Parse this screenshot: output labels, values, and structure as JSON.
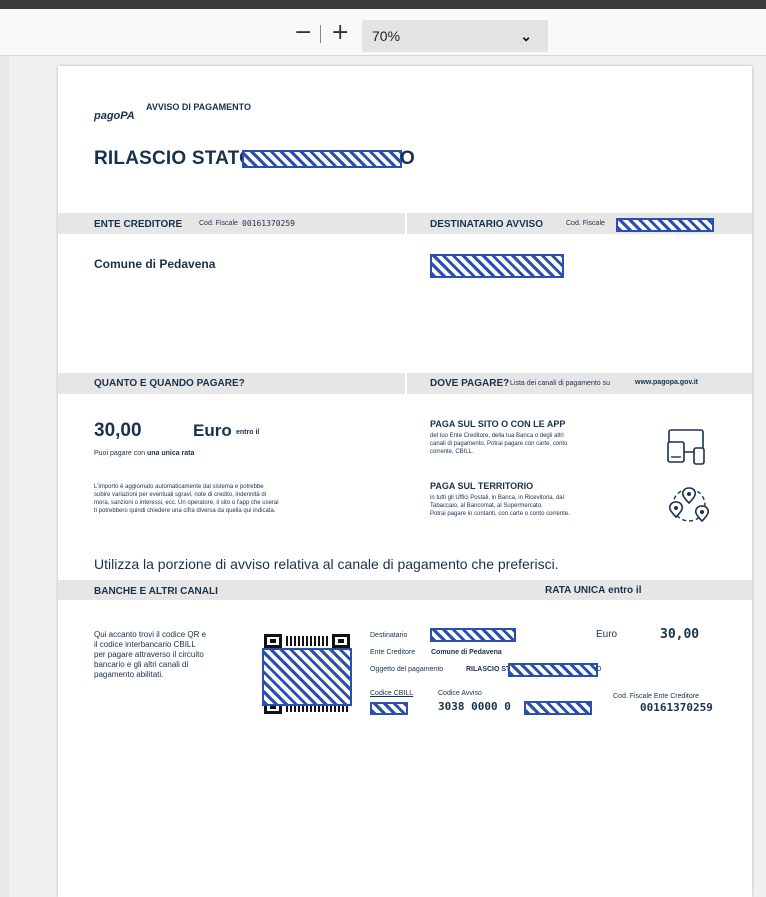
{
  "toolbar": {
    "zoom_out": "−",
    "zoom_in": "+",
    "zoom_value": "70%",
    "dropdown_chevron": "⌄"
  },
  "notice": {
    "logo": "pagoPA",
    "header": "AVVISO DI PAGAMENTO",
    "title_prefix": "RILASCIO STATO F",
    "title_suffix": "O",
    "creditor_band": "ENTE CREDITORE",
    "creditor_cf_label": "Cod. Fiscale",
    "creditor_cf": "00161370259",
    "recipient_band": "DESTINATARIO AVVISO",
    "recipient_cf_label": "Cod. Fiscale",
    "creditor_name": "Comune di Pedavena",
    "how_band": "QUANTO E QUANDO PAGARE?",
    "where_band": "DOVE PAGARE?",
    "where_note": "Lista dei canali di pagamento su",
    "where_site": "www.pagopa.gov.it",
    "amount": "30,00",
    "currency": "Euro",
    "due_label": "entro il",
    "single_prefix": "Puoi pagare con",
    "single_bold": "una unica rata",
    "update_text": [
      "L'importo è aggiornato automaticamente dal sistema e potrebbe",
      "subire variazioni per eventuali sgravi, note di credito, indennità di",
      "mora, sanzioni o interessi, ecc. Un operatore, il sito o l'app che userai",
      "ti potrebbero quindi chiedere una cifra diversa da quella qui indicata."
    ],
    "online_title": "PAGA SUL SITO O CON LE APP",
    "online_text": [
      "del tuo Ente Creditore, della tua Banca o degli altri",
      "canali di pagamento. Potrai pagare con carte, conto",
      "corrente, CBILL."
    ],
    "territory_title": "PAGA SUL TERRITORIO",
    "territory_text": [
      "in tutti gli Uffici Postali, in Banca, in Ricevitoria, dal",
      "Tabaccaio, al Bancomat, al Supermercato.",
      "Potrai pagare in contanti, con carte o conto corrente."
    ],
    "portion_text": "Utilizza la porzione di avviso relativa al canale di pagamento che preferisci.",
    "banks_band": "BANCHE E ALTRI CANALI",
    "rata_bold": "RATA UNICA",
    "rata_rest": "entro il",
    "qr_text": [
      "Qui accanto trovi il codice QR e",
      "il codice interbancario CBILL",
      "per pagare attraverso il circuito",
      "bancario e gli altri canali di",
      "pagamento abilitati."
    ],
    "dest_label": "Destinatario",
    "dest_tail": "I",
    "euro_label": "Euro",
    "euro_amount": "30,00",
    "ente_label": "Ente Creditore",
    "ente_value": "Comune di Pedavena",
    "oggetto_label": "Oggetto del pagamento",
    "oggetto_value": "RILASCIO ST",
    "oggetto_tail": "O",
    "cbill_label": "Codice CBILL",
    "avviso_label": "Codice Avviso",
    "avviso_value": "3038 0000 0",
    "cf_ente_label": "Cod. Fiscale Ente Creditore",
    "cf_ente_value": "00161370259"
  }
}
